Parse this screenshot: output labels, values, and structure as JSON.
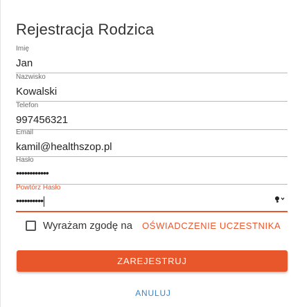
{
  "form": {
    "title": "Rejestracja Rodzica",
    "fields": [
      {
        "label": "Imię",
        "value": "Jan"
      },
      {
        "label": "Nazwisko",
        "value": "Kowalski"
      },
      {
        "label": "Telefon",
        "value": "997456321"
      },
      {
        "label": "Email",
        "value": "kamil@healthszop.pl"
      },
      {
        "label": "Hasło",
        "value": "••••••••••••"
      },
      {
        "label": "Powtórz Hasło",
        "value": "••••••••••"
      }
    ],
    "consent_text": "Wyrażam zgodę na",
    "consent_link": "OŚWIADCZENIE UCZESTNIKA",
    "submit_label": "ZAREJESTRUJ",
    "cancel_label": "ANULUJ"
  },
  "icons": {
    "password_field_icon": "key-icon"
  },
  "colors": {
    "accent": "#e8562c",
    "link_blue": "#3f83c4"
  }
}
